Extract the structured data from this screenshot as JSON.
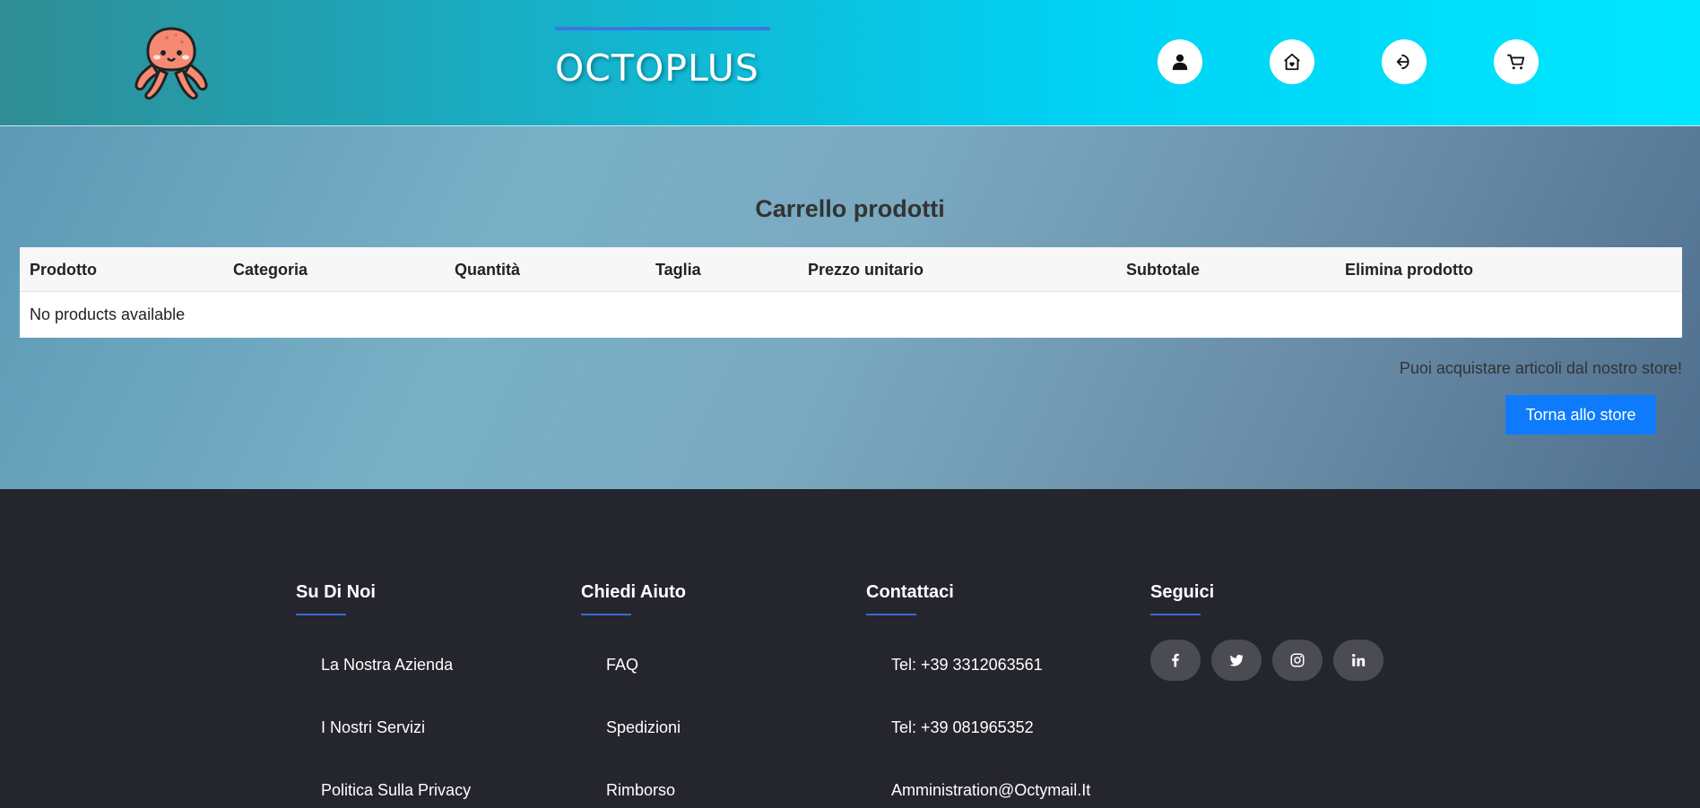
{
  "header": {
    "brand": "OCTOPLUS",
    "nav": [
      "user-icon",
      "home-heart-icon",
      "logout-icon",
      "cart-icon"
    ]
  },
  "cart": {
    "title": "Carrello prodotti",
    "columns": [
      "Prodotto",
      "Categoria",
      "Quantità",
      "Taglia",
      "Prezzo unitario",
      "Subtotale",
      "Elimina prodotto"
    ],
    "empty_message": "No products available",
    "store_hint": "Puoi acquistare articoli dal nostro store!",
    "store_button": "Torna allo store"
  },
  "footer": {
    "columns": [
      {
        "title": "Su Di Noi",
        "links": [
          "La Nostra Azienda",
          "I Nostri Servizi",
          "Politica Sulla Privacy"
        ]
      },
      {
        "title": "Chiedi Aiuto",
        "links": [
          "FAQ",
          "Spedizioni",
          "Rimborso"
        ]
      },
      {
        "title": "Contattaci",
        "links": [
          "Tel: +39 3312063561",
          "Tel: +39 081965352",
          "Amministration@Octymail.It"
        ]
      },
      {
        "title": "Seguici",
        "socials": [
          "facebook-icon",
          "twitter-icon",
          "instagram-icon",
          "linkedin-icon"
        ]
      }
    ]
  },
  "colors": {
    "accent": "#0d7bfc",
    "footer_bg": "#24252d",
    "underline": "#3a6bd6"
  }
}
